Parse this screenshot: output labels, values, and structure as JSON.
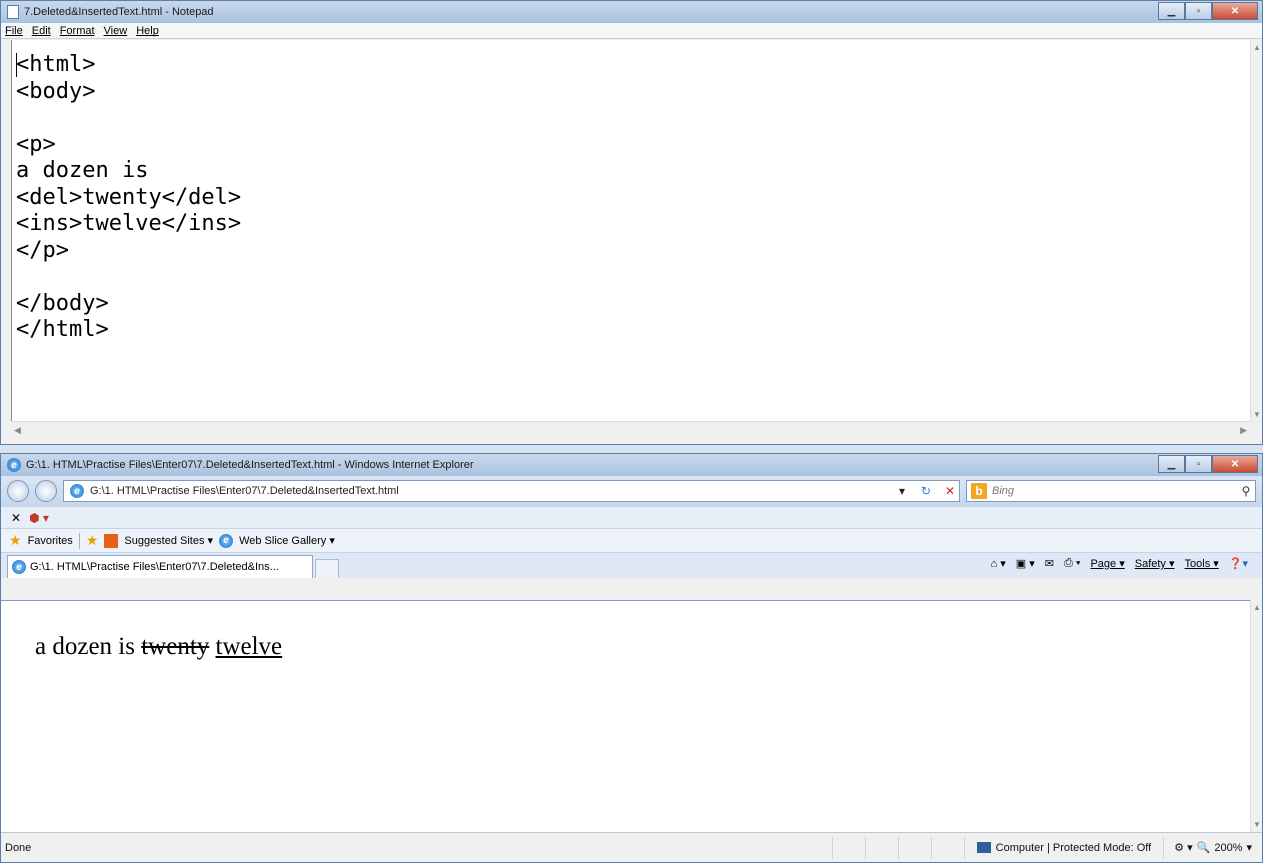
{
  "notepad": {
    "title": "7.Deleted&InsertedText.html - Notepad",
    "menu": [
      "File",
      "Edit",
      "Format",
      "View",
      "Help"
    ],
    "lines": [
      "<html>",
      "<body>",
      "",
      "<p>",
      "a dozen is",
      "<del>twenty</del>",
      "<ins>twelve</ins>",
      "</p>",
      "",
      "</body>",
      "</html>"
    ]
  },
  "ie": {
    "title": "G:\\1. HTML\\Practise Files\\Enter07\\7.Deleted&InsertedText.html - Windows Internet Explorer",
    "address": "G:\\1. HTML\\Practise Files\\Enter07\\7.Deleted&InsertedText.html",
    "search_placeholder": "Bing",
    "favorites_label": "Favorites",
    "suggested_sites": "Suggested Sites ▾",
    "web_slice": "Web Slice Gallery ▾",
    "tab_title": "G:\\1. HTML\\Practise Files\\Enter07\\7.Deleted&Ins...",
    "tools": {
      "page": "Page ▾",
      "safety": "Safety ▾",
      "tools": "Tools ▾"
    },
    "page_text": {
      "plain": "a dozen is",
      "deleted": "twenty",
      "inserted": "twelve"
    },
    "status": {
      "done": "Done",
      "zone": "Computer | Protected Mode: Off",
      "zoom": "200%"
    }
  }
}
